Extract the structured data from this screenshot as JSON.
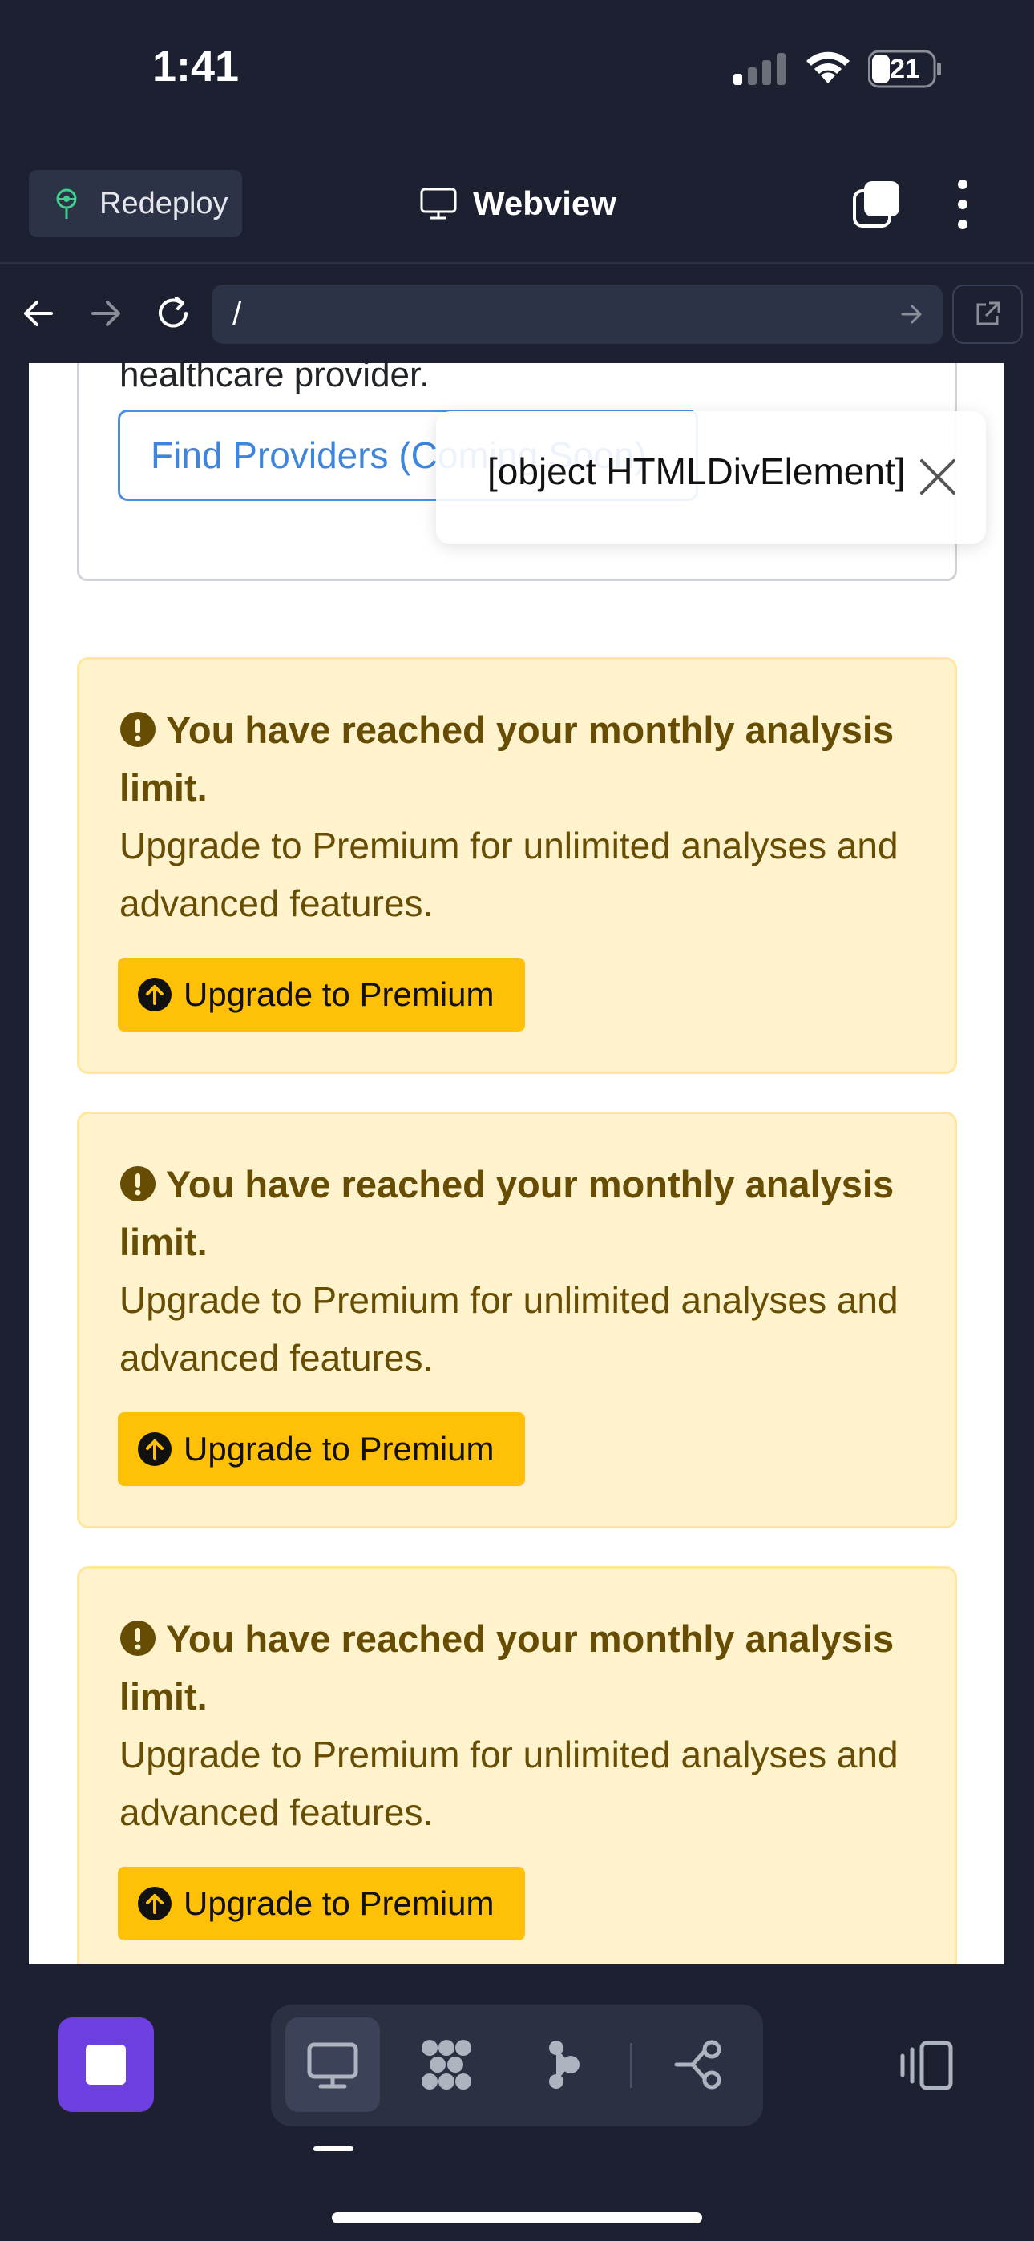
{
  "status_bar": {
    "time": "1:41",
    "battery": "21"
  },
  "header": {
    "redeploy_label": "Redeploy",
    "title": "Webview"
  },
  "browser": {
    "url": "/"
  },
  "page": {
    "provider_text": "healthcare provider.",
    "find_providers_label": "Find Providers (Coming Soon)",
    "toast_text": "[object HTMLDivElement]",
    "alerts": [
      {
        "heading": "You have reached your monthly analysis limit.",
        "body": "Upgrade to Premium for unlimited analyses and advanced features.",
        "button": "Upgrade to Premium"
      },
      {
        "heading": "You have reached your monthly analysis limit.",
        "body": "Upgrade to Premium for unlimited analyses and advanced features.",
        "button": "Upgrade to Premium"
      },
      {
        "heading": "You have reached your monthly analysis limit.",
        "body": "Upgrade to Premium for unlimited analyses and advanced features.",
        "button": "Upgrade to Premium"
      }
    ]
  },
  "toolbar": {
    "tools": [
      "monitor-icon",
      "modules-icon",
      "agent-icon",
      "connections-icon"
    ],
    "active_tool": "monitor-icon"
  },
  "colors": {
    "background": "#1c2030",
    "alert_bg": "#fff3cd",
    "alert_text": "#664d03",
    "button_yellow": "#ffc107",
    "link_blue": "#3e86dd",
    "stop_purple": "#6d3fe0"
  }
}
